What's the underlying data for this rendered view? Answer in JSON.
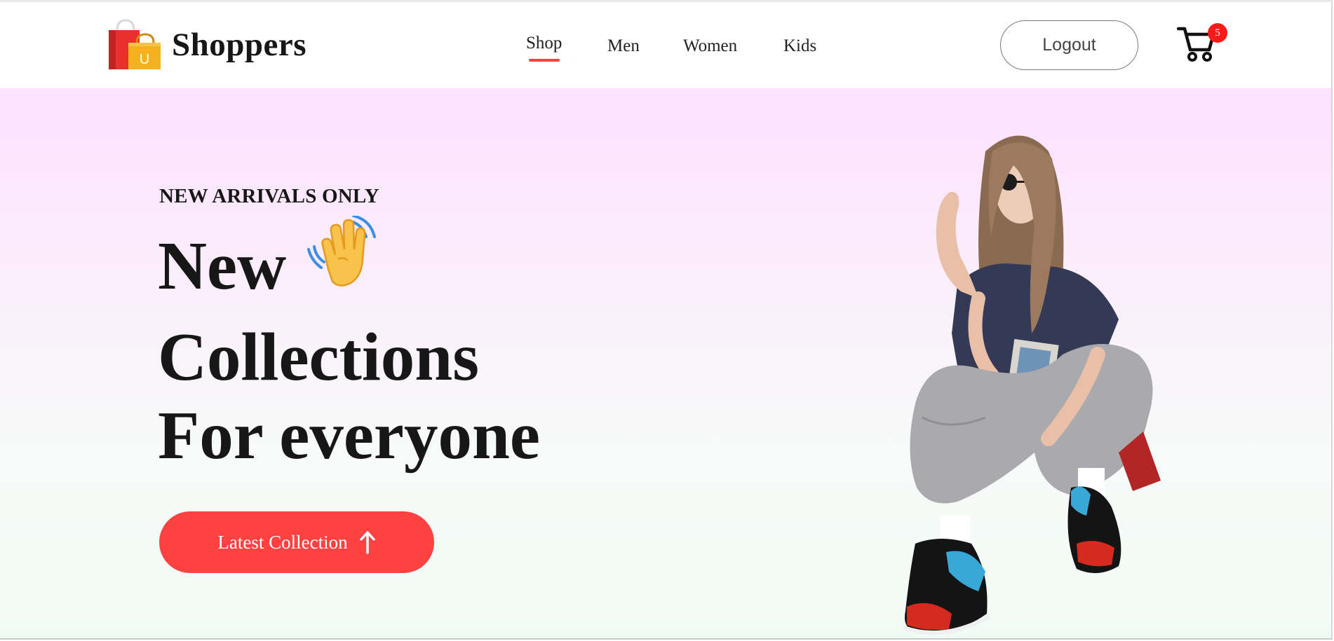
{
  "brand": {
    "name": "Shoppers",
    "logo_icon": "shopping-bags-icon",
    "logo_letter": "U"
  },
  "nav": {
    "items": [
      {
        "label": "Shop",
        "active": true
      },
      {
        "label": "Men",
        "active": false
      },
      {
        "label": "Women",
        "active": false
      },
      {
        "label": "Kids",
        "active": false
      }
    ]
  },
  "header": {
    "logout_label": "Logout",
    "cart_icon": "cart-icon",
    "cart_count": "5"
  },
  "hero": {
    "kicker": "NEW ARRIVALS ONLY",
    "headline_lines": [
      "New",
      "Collections",
      "For everyone"
    ],
    "hand_icon": "waving-hand-icon",
    "cta_label": "Latest Collection",
    "cta_icon": "arrow-icon",
    "image": "model-photo"
  },
  "colors": {
    "accent": "#ff4141",
    "text": "#171717",
    "hero_top": "#fde1ff",
    "hero_bottom": "#f1fbf5"
  }
}
